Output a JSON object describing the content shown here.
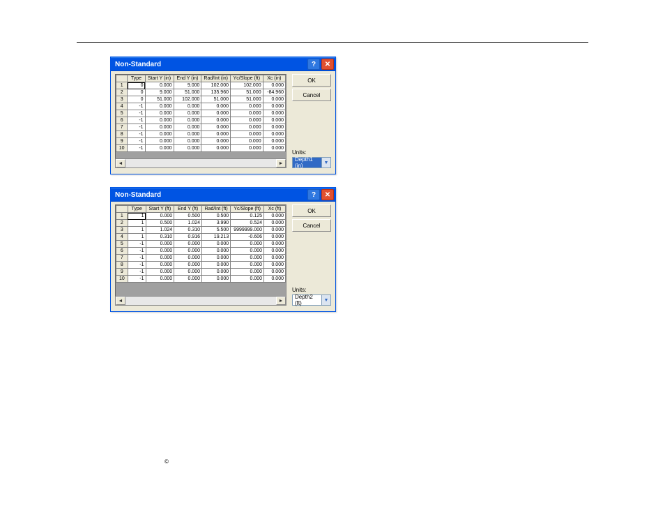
{
  "dialog1": {
    "title": "Non-Standard",
    "columns": [
      "Type",
      "Start Y (in)",
      "End Y (in)",
      "Rad/Int (in)",
      "Yc/Slope (ft)",
      "Xc (in)"
    ],
    "rows": [
      [
        "0",
        "0.000",
        "9.000",
        "102.000",
        "102.000",
        "0.000"
      ],
      [
        "0",
        "9.000",
        "51.000",
        "135.960",
        "51.000",
        "-84.960"
      ],
      [
        "0",
        "51.000",
        "102.000",
        "51.000",
        "51.000",
        "0.000"
      ],
      [
        "-1",
        "0.000",
        "0.000",
        "0.000",
        "0.000",
        "0.000"
      ],
      [
        "-1",
        "0.000",
        "0.000",
        "0.000",
        "0.000",
        "0.000"
      ],
      [
        "-1",
        "0.000",
        "0.000",
        "0.000",
        "0.000",
        "0.000"
      ],
      [
        "-1",
        "0.000",
        "0.000",
        "0.000",
        "0.000",
        "0.000"
      ],
      [
        "-1",
        "0.000",
        "0.000",
        "0.000",
        "0.000",
        "0.000"
      ],
      [
        "-1",
        "0.000",
        "0.000",
        "0.000",
        "0.000",
        "0.000"
      ],
      [
        "-1",
        "0.000",
        "0.000",
        "0.000",
        "0.000",
        "0.000"
      ]
    ],
    "ok": "OK",
    "cancel": "Cancel",
    "units_label": "Units:",
    "units_value": "Depth1 (in)"
  },
  "dialog2": {
    "title": "Non-Standard",
    "columns": [
      "Type",
      "Start Y (ft)",
      "End Y (ft)",
      "Rad/Int (ft)",
      "Yc/Slope (ft)",
      "Xc (ft)"
    ],
    "rows": [
      [
        "1",
        "0.000",
        "0.500",
        "0.500",
        "0.125",
        "0.000"
      ],
      [
        "1",
        "0.500",
        "1.024",
        "3.990",
        "0.524",
        "0.000"
      ],
      [
        "1",
        "1.024",
        "0.310",
        "5.500",
        "9999999.000",
        "0.000"
      ],
      [
        "1",
        "0.310",
        "0.916",
        "19.213",
        "-0.606",
        "0.000"
      ],
      [
        "-1",
        "0.000",
        "0.000",
        "0.000",
        "0.000",
        "0.000"
      ],
      [
        "-1",
        "0.000",
        "0.000",
        "0.000",
        "0.000",
        "0.000"
      ],
      [
        "-1",
        "0.000",
        "0.000",
        "0.000",
        "0.000",
        "0.000"
      ],
      [
        "-1",
        "0.000",
        "0.000",
        "0.000",
        "0.000",
        "0.000"
      ],
      [
        "-1",
        "0.000",
        "0.000",
        "0.000",
        "0.000",
        "0.000"
      ],
      [
        "-1",
        "0.000",
        "0.000",
        "0.000",
        "0.000",
        "0.000"
      ]
    ],
    "ok": "OK",
    "cancel": "Cancel",
    "units_label": "Units:",
    "units_value": "Depth2 (ft)"
  },
  "copyright": "©"
}
